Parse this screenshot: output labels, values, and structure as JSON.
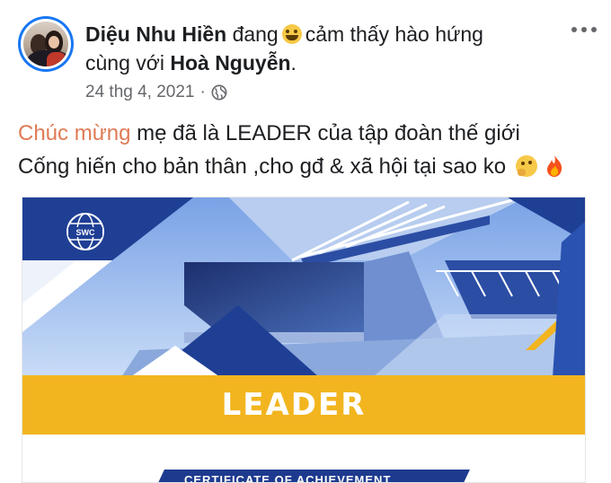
{
  "post": {
    "author": "Diệu Nhu Hiền",
    "activity_prefix": "đang",
    "activity_emoji": "grinning-face-with-star-eyes",
    "activity_text": "cảm thấy hào hứng",
    "with_prefix": "cùng với",
    "tagged_user": "Hoà Nguyễn",
    "tagged_suffix": ".",
    "date": "24 thg 4, 2021",
    "separator": "·",
    "privacy_icon": "globe-icon",
    "more_icon": "more-options-icon",
    "text_line1_highlight": "Chúc mừng",
    "text_line1_rest": "mẹ đã là LEADER của tập đoàn thế giới",
    "text_line2": "Cống hiến cho bản thân ,cho gđ & xã hội tại sao ko",
    "text_line2_emojis": [
      "thinking-face-icon",
      "fire-icon"
    ]
  },
  "certificate": {
    "logo_text": "SWC",
    "badge_text": "LEADER",
    "subtitle": "CERTIFICATE OF ACHIEVEMENT"
  },
  "colors": {
    "highlight": "#e07a55",
    "brand_blue": "#1d3a8f",
    "accent_yellow": "#f2b51f",
    "meta_gray": "#65676b"
  }
}
